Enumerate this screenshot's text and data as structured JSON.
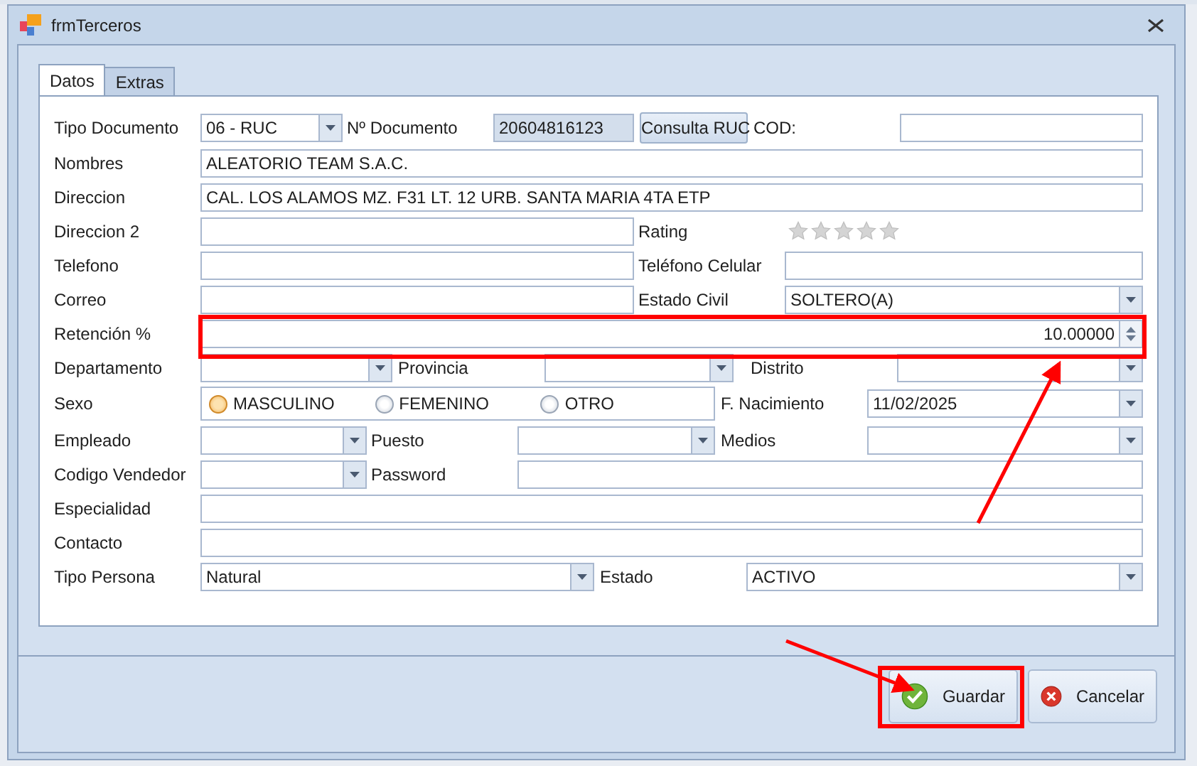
{
  "window": {
    "title": "frmTerceros"
  },
  "tabs": [
    {
      "label": "Datos",
      "selected": true
    },
    {
      "label": "Extras",
      "selected": false
    }
  ],
  "form_rows": [
    {
      "cells": [
        {
          "kind": "label",
          "text": "Tipo Documento"
        },
        {
          "kind": "combo",
          "value": "06 - RUC"
        },
        {
          "kind": "label",
          "text": "Nº Documento"
        },
        {
          "kind": "readonly",
          "value": "20604816123"
        },
        {
          "kind": "button",
          "text": "Consulta RUC"
        },
        {
          "kind": "label",
          "text": "COD:"
        },
        {
          "kind": "text"
        }
      ]
    },
    {
      "cells": [
        {
          "kind": "label",
          "text": "Nombres"
        },
        {
          "kind": "text",
          "value": "ALEATORIO TEAM S.A.C."
        }
      ]
    },
    {
      "cells": [
        {
          "kind": "label",
          "text": "Direccion"
        },
        {
          "kind": "text",
          "value": "CAL. LOS ALAMOS MZ. F31 LT. 12 URB. SANTA MARIA 4TA ETP"
        }
      ]
    },
    {
      "cells": [
        {
          "kind": "label",
          "text": "Direccion 2"
        },
        {
          "kind": "text"
        },
        {
          "kind": "label",
          "text": "Rating"
        },
        {
          "kind": "rating",
          "stars": 0
        }
      ]
    },
    {
      "cells": [
        {
          "kind": "label",
          "text": "Telefono"
        },
        {
          "kind": "text"
        },
        {
          "kind": "label",
          "text": "Teléfono Celular"
        },
        {
          "kind": "text"
        }
      ]
    },
    {
      "cells": [
        {
          "kind": "label",
          "text": "Correo"
        },
        {
          "kind": "text"
        },
        {
          "kind": "label",
          "text": "Estado Civil"
        },
        {
          "kind": "combo",
          "value": "SOLTERO(A)"
        }
      ]
    },
    {
      "cells": [
        {
          "kind": "label",
          "text": "Retención %"
        },
        {
          "kind": "spin",
          "value": "10.00000"
        }
      ]
    },
    {
      "cells": [
        {
          "kind": "label",
          "text": "Departamento"
        },
        {
          "kind": "combo"
        },
        {
          "kind": "label",
          "text": "Provincia"
        },
        {
          "kind": "combo"
        },
        {
          "kind": "label",
          "text": "Distrito"
        },
        {
          "kind": "combo"
        }
      ]
    },
    {
      "cells": [
        {
          "kind": "label",
          "text": "Sexo"
        },
        {
          "kind": "radios",
          "options": [
            {
              "label": "MASCULINO",
              "selected": true
            },
            {
              "label": "FEMENINO",
              "selected": false
            },
            {
              "label": "OTRO",
              "selected": false
            }
          ]
        },
        {
          "kind": "label",
          "text": "F. Nacimiento"
        },
        {
          "kind": "combo",
          "value": "11/02/2025"
        }
      ]
    },
    {
      "cells": [
        {
          "kind": "label",
          "text": "Empleado"
        },
        {
          "kind": "combo"
        },
        {
          "kind": "label",
          "text": "Puesto"
        },
        {
          "kind": "combo"
        },
        {
          "kind": "label",
          "text": "Medios"
        },
        {
          "kind": "combo"
        }
      ]
    },
    {
      "cells": [
        {
          "kind": "label",
          "text": "Codigo Vendedor"
        },
        {
          "kind": "combo"
        },
        {
          "kind": "label",
          "text": "Password"
        },
        {
          "kind": "text"
        }
      ]
    },
    {
      "cells": [
        {
          "kind": "label",
          "text": "Especialidad"
        },
        {
          "kind": "text"
        }
      ]
    },
    {
      "cells": [
        {
          "kind": "label",
          "text": "Contacto"
        },
        {
          "kind": "text"
        }
      ]
    },
    {
      "cells": [
        {
          "kind": "label",
          "text": "Tipo Persona"
        },
        {
          "kind": "combo",
          "value": "Natural"
        },
        {
          "kind": "label",
          "text": "Estado"
        },
        {
          "kind": "combo",
          "value": "ACTIVO"
        }
      ]
    }
  ],
  "buttons": [
    {
      "kind": "ok",
      "label": "Guardar"
    },
    {
      "kind": "cancel",
      "label": "Cancelar"
    }
  ]
}
